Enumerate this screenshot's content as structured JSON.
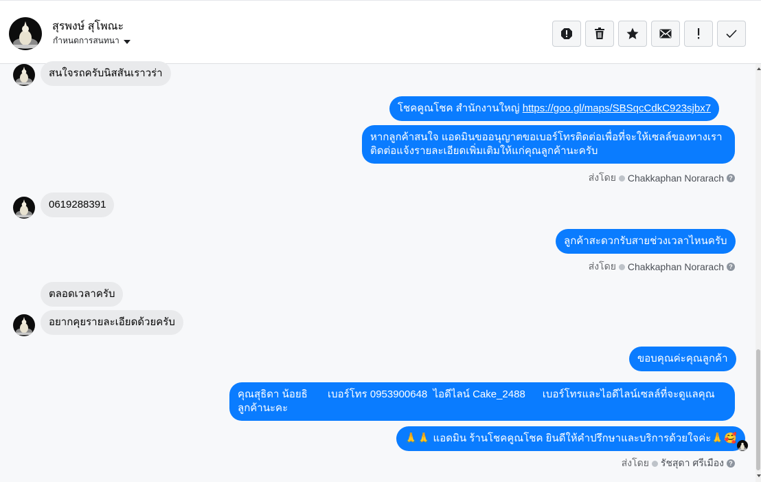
{
  "header": {
    "contact_name": "สุรพงษ์ สุโพณะ",
    "assign_label": "กำหนดการสนทนา"
  },
  "actions": [
    {
      "icon": "spam-report-icon"
    },
    {
      "icon": "trash-icon"
    },
    {
      "icon": "star-icon"
    },
    {
      "icon": "envelope-icon"
    },
    {
      "icon": "exclamation-icon"
    },
    {
      "icon": "checkmark-icon"
    }
  ],
  "messages": {
    "m1": "สนใจรถครับนิสสันเราวร่า",
    "m2_text": "โชคคูณโชค สำนักงานใหญ่ ",
    "m2_link": "https://goo.gl/maps/SBSqcCdkC923sjbx7",
    "m3_line1": "หากลูกค้าสนใจ แอดมินขออนุญาตขอเบอร์โทรติดต่อเพื่อที่จะให้เซลล์ของทางเรา",
    "m3_line2": "ติดต่อแจ้งรายละเอียดเพิ่มเติมให้แก่คุณลูกค้านะครับ",
    "m4": "0619288391",
    "m5": "ลูกค้าสะดวกรับสายช่วงเวลาไหนครับ",
    "m6": "ตลอดเวลาครับ",
    "m7": "อยากคุยรายละเอียดด้วยครับ",
    "m8": "ขอบคุณค่ะคุณลูกค้า",
    "m9_line1": "คุณสุธิดา น้อยธิ       เบอร์โทร 0953900648  ไอดีไลน์ Cake_2488      เบอร์โทรและไอดีไลน์เซลล์ที่จะดูแลคุณ",
    "m9_line2": "ลูกค้านะคะ",
    "m10_prefix": "🙏🙏",
    "m10_text": "แอดมิน ร้านโชคคูณโชค ยินดีให้คำปรึกษาและบริการด้วยใจค่ะ",
    "m10_suffix": "🙏🥰"
  },
  "sent_by": {
    "label": "ส่งโดย",
    "sender1": "Chakkaphan Norarach",
    "sender2": "Chakkaphan Norarach",
    "sender3": "รัชสุดา ศรีเมือง"
  },
  "colors": {
    "outgoing_bubble": "#0a7cff",
    "incoming_bubble": "#e9eaec"
  }
}
